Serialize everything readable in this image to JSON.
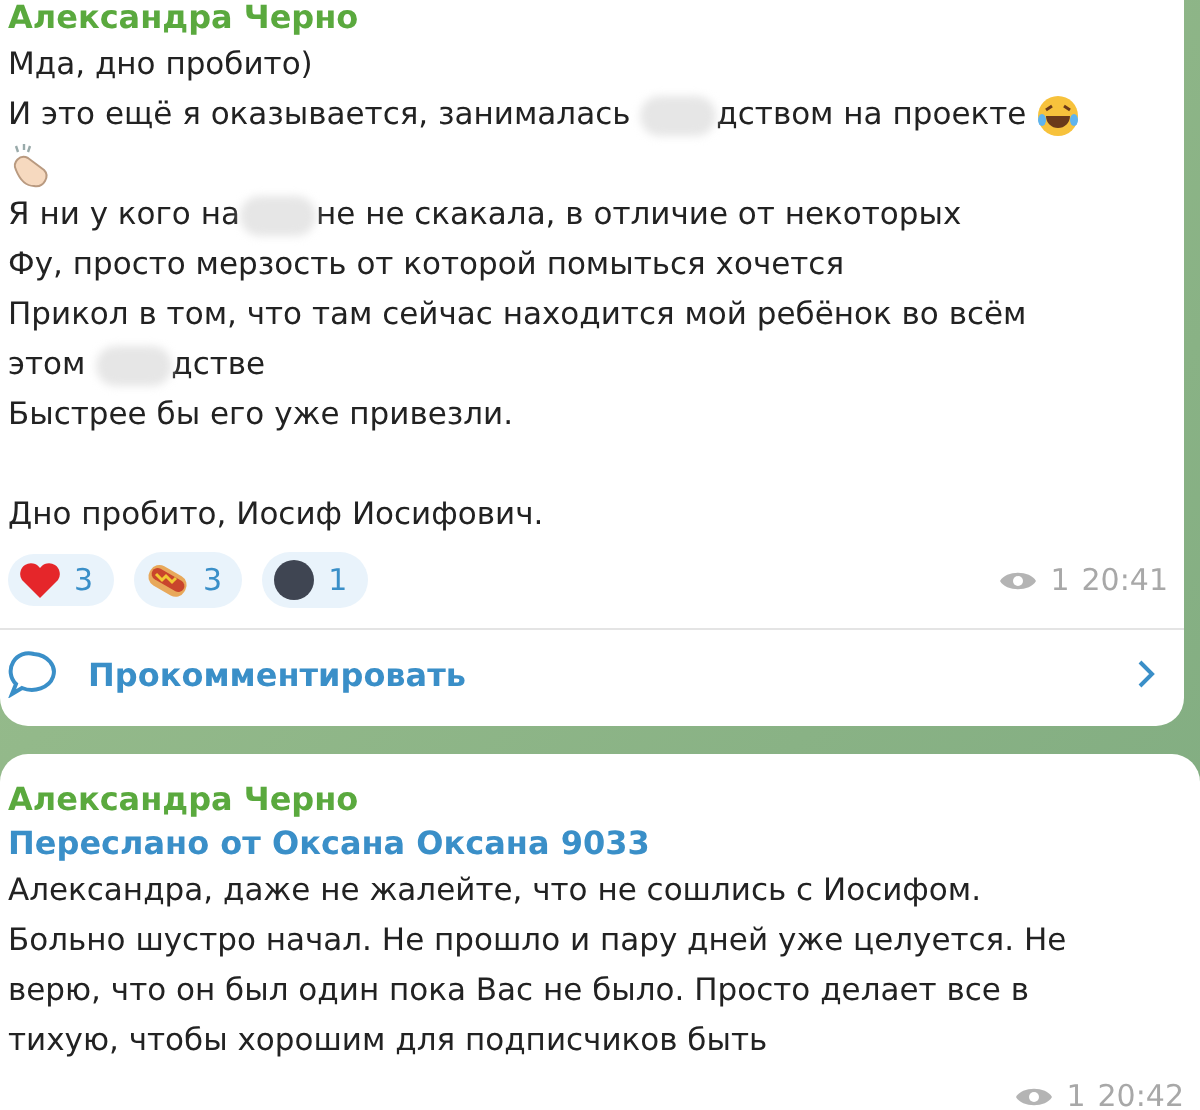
{
  "messages": [
    {
      "author": "Александра Черно",
      "lines": [
        [
          {
            "kind": "text",
            "text": "Мда, дно пробито)"
          }
        ],
        [
          {
            "kind": "text",
            "text": "И это ещё я оказывается, занималась "
          },
          {
            "kind": "blur"
          },
          {
            "kind": "text",
            "text": "дством на проекте "
          },
          {
            "kind": "laugh"
          }
        ],
        [
          {
            "kind": "clap"
          }
        ],
        [
          {
            "kind": "text",
            "text": "Я ни у кого на"
          },
          {
            "kind": "blur"
          },
          {
            "kind": "text",
            "text": "не не скакала, в отличие от некоторых"
          }
        ],
        [
          {
            "kind": "text",
            "text": "Фу, просто мерзость от которой помыться хочется"
          }
        ],
        [
          {
            "kind": "text",
            "text": "Прикол в том, что там сейчас находится мой ребёнок во всём"
          }
        ],
        [
          {
            "kind": "text",
            "text": "этом "
          },
          {
            "kind": "blur"
          },
          {
            "kind": "text",
            "text": "дстве"
          }
        ],
        [
          {
            "kind": "text",
            "text": "Быстрее бы его уже привезли."
          }
        ],
        [
          {
            "kind": "gap"
          }
        ],
        [
          {
            "kind": "text",
            "text": "Дно пробито, Иосиф Иосифович."
          }
        ]
      ],
      "reactions": [
        {
          "kind": "heart",
          "count": "3"
        },
        {
          "kind": "hotdog",
          "count": "3"
        },
        {
          "kind": "moon",
          "count": "1"
        }
      ],
      "views": "1",
      "time": "20:41",
      "comment_label": "Прокомментировать"
    },
    {
      "author": "Александра Черно",
      "forwarded": "Переслано от Оксана Оксана 9033",
      "lines": [
        [
          {
            "kind": "text",
            "text": "Александра, даже не жалейте, что не сошлись с Иосифом."
          }
        ],
        [
          {
            "kind": "text",
            "text": "Больно шустро начал. Не прошло и пару дней уже целуется. Не"
          }
        ],
        [
          {
            "kind": "text",
            "text": "верю, что он был один пока Вас не было. Просто делает все в"
          }
        ],
        [
          {
            "kind": "text",
            "text": "тихую, чтобы хорошим для подписчиков быть"
          }
        ]
      ],
      "views": "1",
      "time": "20:42"
    }
  ]
}
